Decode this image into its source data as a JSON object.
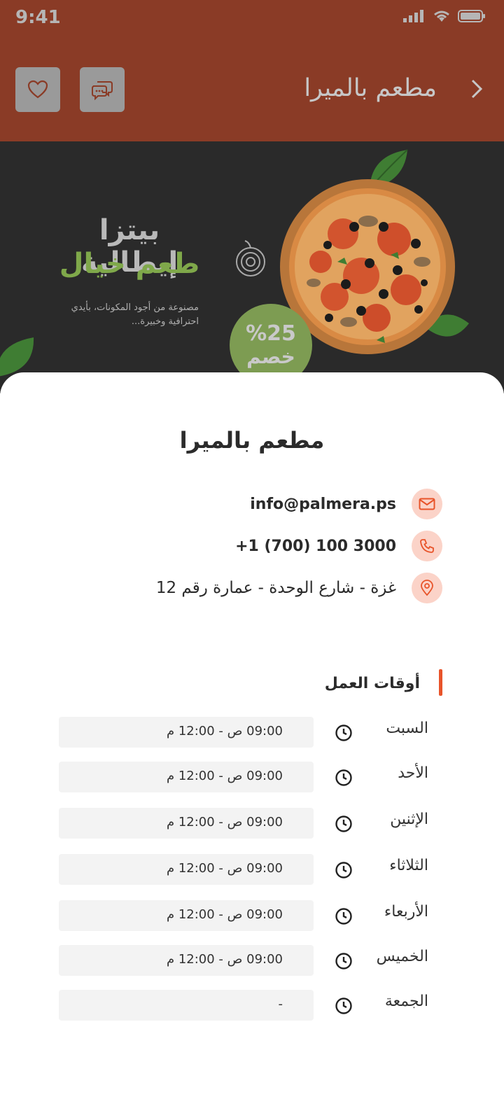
{
  "status_bar": {
    "time": "9:41"
  },
  "header": {
    "title": "مطعم بالميرا",
    "icons": [
      "heart-icon",
      "chat-icon",
      "chevron-right-icon"
    ],
    "bg_color": "#8a3b26"
  },
  "banner": {
    "title": "بيتزا إيطالية",
    "subtitle": "طعم خيال",
    "description": "مصنوعة من أجود المكونات، بأيدي احترافية وخبيرة...",
    "discount_percent": "%25",
    "discount_label": "خصم"
  },
  "restaurant": {
    "name": "مطعم بالميرا",
    "email": "info@palmera.ps",
    "phone": "+1 (700) 100 3000",
    "address": "غزة - شارع الوحدة - عمارة رقم 12"
  },
  "working_hours": {
    "title": "أوقات العمل",
    "accent_color": "#e8542a",
    "days": [
      {
        "day": "السبت",
        "hours": "09:00 ص - 12:00 م"
      },
      {
        "day": "الأحد",
        "hours": "09:00 ص - 12:00 م"
      },
      {
        "day": "الإثنين",
        "hours": "09:00 ص - 12:00 م"
      },
      {
        "day": "الثلاثاء",
        "hours": "09:00 ص - 12:00 م"
      },
      {
        "day": "الأربعاء",
        "hours": "09:00 ص - 12:00 م"
      },
      {
        "day": "الخميس",
        "hours": "09:00 ص - 12:00 م"
      },
      {
        "day": "الجمعة",
        "hours": "-"
      }
    ]
  }
}
